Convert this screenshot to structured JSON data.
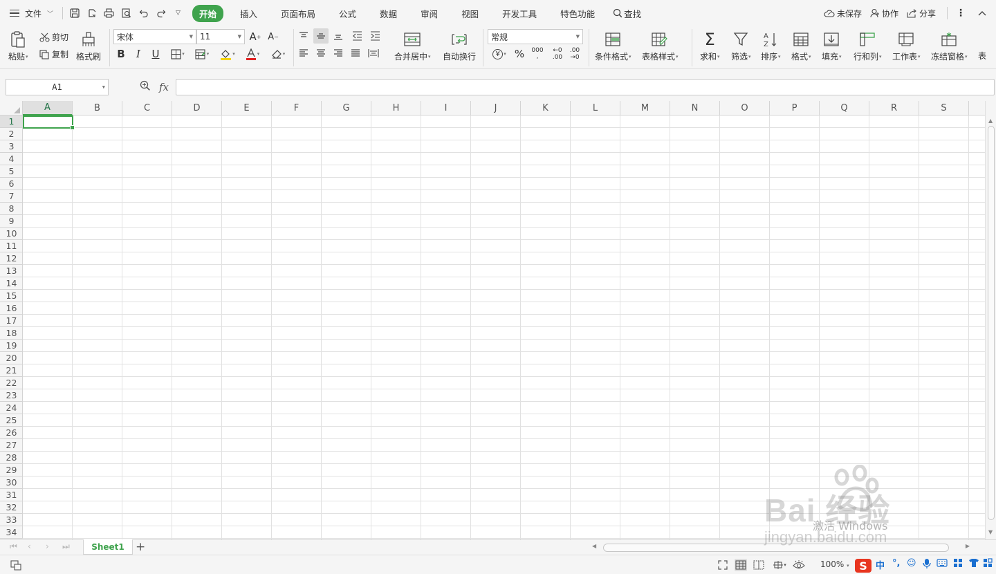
{
  "menubar": {
    "file_label": "文件",
    "tabs": [
      {
        "label": "开始",
        "active": true
      },
      {
        "label": "插入"
      },
      {
        "label": "页面布局"
      },
      {
        "label": "公式"
      },
      {
        "label": "数据"
      },
      {
        "label": "审阅"
      },
      {
        "label": "视图"
      },
      {
        "label": "开发工具"
      },
      {
        "label": "特色功能"
      }
    ],
    "search_label": "查找",
    "unsaved_label": "未保存",
    "collab_label": "协作",
    "share_label": "分享"
  },
  "ribbon": {
    "paste_label": "粘贴",
    "cut_label": "剪切",
    "copy_label": "复制",
    "format_painter_label": "格式刷",
    "font_name": "宋体",
    "font_size": "11",
    "merge_center_label": "合并居中",
    "wrap_text_label": "自动换行",
    "number_format": "常规",
    "cond_format_label": "条件格式",
    "table_style_label": "表格样式",
    "sum_label": "求和",
    "filter_label": "筛选",
    "sort_label": "排序",
    "format_label": "格式",
    "fill_label": "填充",
    "row_col_label": "行和列",
    "worksheet_label": "工作表",
    "freeze_label": "冻结窗格",
    "more_label": "表",
    "accent_color": "#3fa34d",
    "font_color": "#e02020",
    "highlight_color": "#f5d400"
  },
  "formula_bar": {
    "name_box": "A1",
    "fx_label": "fx",
    "formula": ""
  },
  "grid": {
    "columns": [
      "A",
      "B",
      "C",
      "D",
      "E",
      "F",
      "G",
      "H",
      "I",
      "J",
      "K",
      "L",
      "M",
      "N",
      "O",
      "P",
      "Q",
      "R",
      "S"
    ],
    "rows": [
      "1",
      "2",
      "3",
      "4",
      "5",
      "6",
      "7",
      "8",
      "9",
      "10",
      "11",
      "12",
      "13",
      "14",
      "15",
      "16",
      "17",
      "18",
      "19",
      "20",
      "21",
      "22",
      "23",
      "24",
      "25",
      "26",
      "27",
      "28",
      "29",
      "30",
      "31",
      "32",
      "33",
      "34"
    ],
    "active_cell": "A1"
  },
  "sheets": {
    "tabs": [
      "Sheet1"
    ],
    "add_label": "+"
  },
  "statusbar": {
    "zoom": "100%",
    "ime_lang": "中"
  },
  "watermark": {
    "brand": "Bai  经验",
    "activate": "激活 Windows",
    "sub": "jingyan.baidu.com"
  }
}
